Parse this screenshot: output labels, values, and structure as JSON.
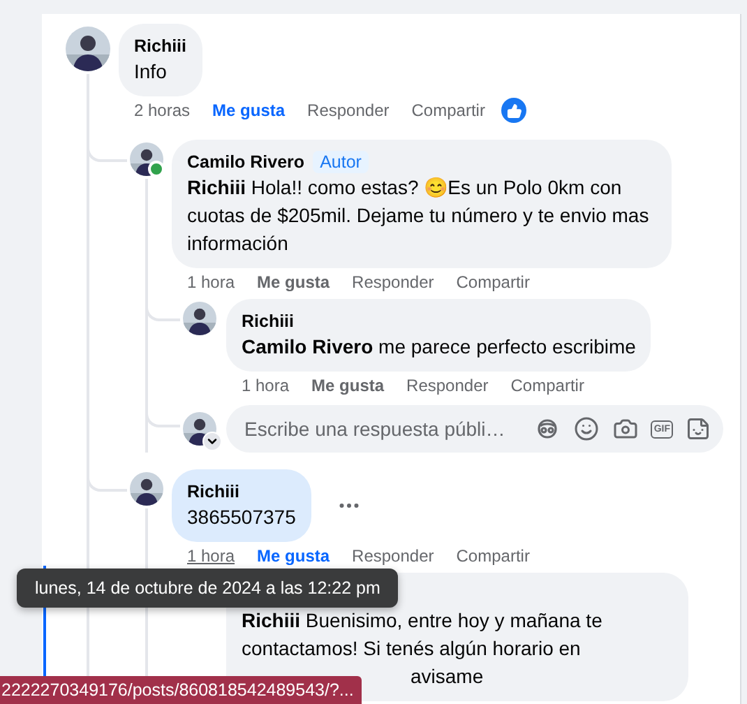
{
  "thread": {
    "author": "Richiii",
    "text": "Info",
    "reacted": true,
    "actions": {
      "time": "2 horas",
      "time_underlined": false,
      "like": "Me gusta",
      "liked": true,
      "reply": "Responder",
      "share": "Compartir"
    },
    "replies": [
      {
        "author": "Camilo Rivero",
        "badge": "Autor",
        "text": "**Richiii** Hola!! como estas? 😊Es un Polo 0km con cuotas de $205mil. Dejame tu número y te envio mas información",
        "online": true,
        "actions": {
          "time": "1 hora",
          "time_underlined": false,
          "like": "Me gusta",
          "liked": false,
          "reply": "Responder",
          "share": "Compartir"
        },
        "replies": [
          {
            "author": "Richiii",
            "text": "**Camilo Rivero** me parece perfecto escribime",
            "actions": {
              "time": "1 hora",
              "time_underlined": false,
              "like": "Me gusta",
              "liked": false,
              "reply": "Responder",
              "share": "Compartir"
            }
          }
        ],
        "reply_box": {
          "placeholder": "Escribe una respuesta públi…",
          "gif_label": "GIF"
        }
      },
      {
        "author": "Richiii",
        "text": "3865507375",
        "highlighted": true,
        "more_menu": true,
        "actions": {
          "time": "1 hora",
          "time_underlined": true,
          "like": "Me gusta",
          "liked": true,
          "reply": "Responder",
          "share": "Compartir"
        },
        "replies": [
          {
            "text": "**Richiii** Buenisimo, entre hoy y mañana te contactamos! Si tenés algún horario en",
            "text_tail": "avisame"
          }
        ]
      }
    ]
  },
  "tooltip": {
    "text": "lunes, 14 de octubre de 2024 a las 12:22 pm"
  },
  "status_bar": {
    "url": "2222270349176/posts/860818542489543/?..."
  }
}
